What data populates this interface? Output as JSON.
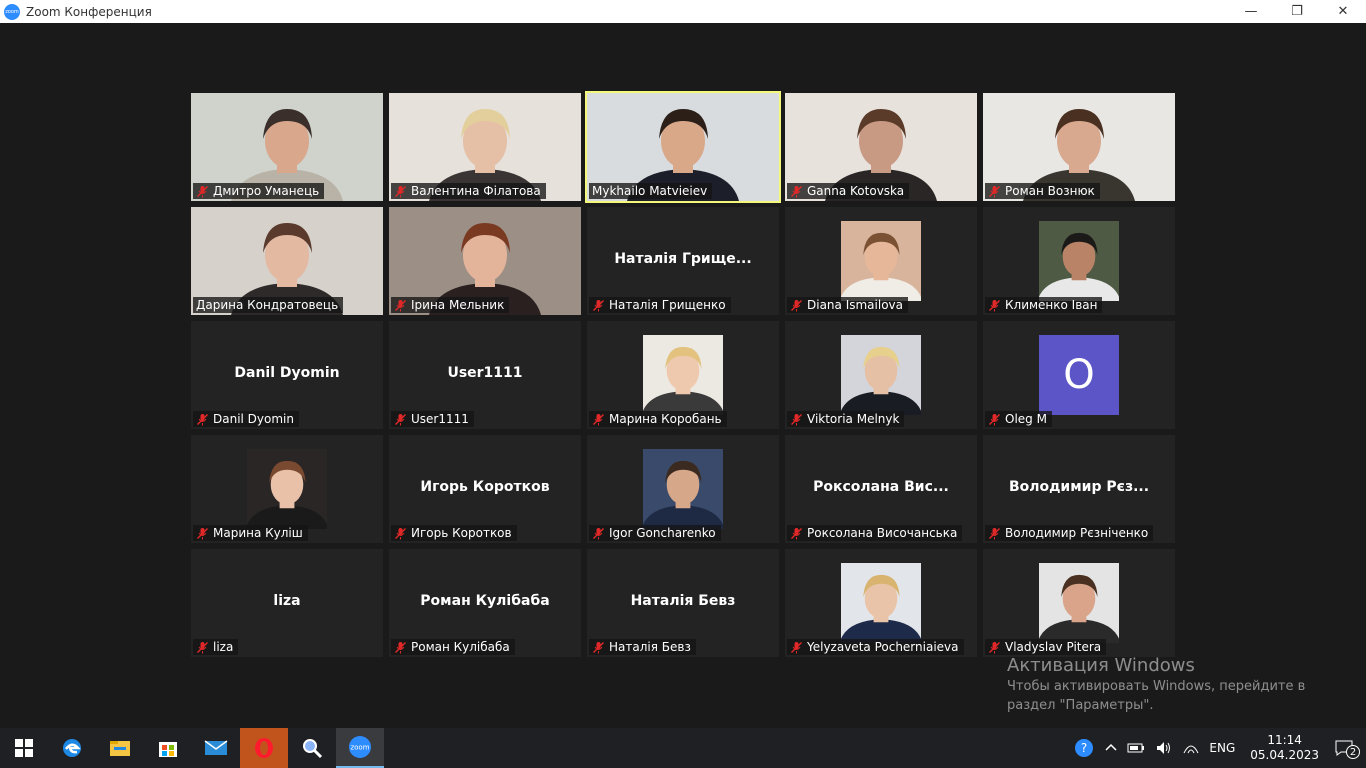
{
  "window": {
    "title": "Zoom Конференция",
    "app_icon_text": "zoom"
  },
  "participants": [
    {
      "name": "Дмитро Уманець",
      "muted": true,
      "kind": "video",
      "bg": "#cfd3cc",
      "skin": "#d8a78c",
      "hair": "#3a2f2a",
      "shirt": "#b9b2a6"
    },
    {
      "name": "Валентина Філатова",
      "muted": true,
      "kind": "video",
      "bg": "#e6e1da",
      "skin": "#e5bfa6",
      "hair": "#e3cf9c",
      "shirt": "#3a3434"
    },
    {
      "name": "Mykhailo Matvieiev",
      "muted": false,
      "kind": "video",
      "active": true,
      "bg": "#d9dcdf",
      "skin": "#d8a889",
      "hair": "#2b1f18",
      "shirt": "#1c1f2a"
    },
    {
      "name": "Ganna Kotovska",
      "muted": true,
      "kind": "video",
      "bg": "#e8e2dd",
      "skin": "#c89a83",
      "hair": "#5a3a28",
      "shirt": "#2a2626"
    },
    {
      "name": "Роман Вознюк",
      "muted": true,
      "kind": "video",
      "bg": "#e9e7e4",
      "skin": "#d8a98f",
      "hair": "#4a3020",
      "shirt": "#39362f"
    },
    {
      "name": "Дарина Кондратовець",
      "muted": false,
      "kind": "video",
      "bg": "#d6d1cb",
      "skin": "#e3b9a2",
      "hair": "#5a3a2c",
      "shirt": "#2e2a2a"
    },
    {
      "name": "Ірина Мельник",
      "muted": true,
      "kind": "video",
      "bg": "#9c8f86",
      "skin": "#e4b49a",
      "hair": "#7a3a22",
      "shirt": "#2a2020"
    },
    {
      "name": "Наталія Грищенко",
      "muted": true,
      "kind": "text",
      "center_label": "Наталія Грище..."
    },
    {
      "name": "Diana Ismailova",
      "muted": true,
      "kind": "avatar",
      "bg": "#d9b49c",
      "skin": "#e6b899",
      "hair": "#7a5233",
      "shirt": "#f0ece6"
    },
    {
      "name": "Клименко Іван",
      "muted": true,
      "kind": "avatar",
      "bg": "#4f5a45",
      "skin": "#b88366",
      "hair": "#1c1a18",
      "shirt": "#e8e8e8"
    },
    {
      "name": "Danil Dyomin",
      "muted": true,
      "kind": "text",
      "center_label": "Danil Dyomin"
    },
    {
      "name": "User1111",
      "muted": true,
      "kind": "text",
      "center_label": "User1111"
    },
    {
      "name": "Марина Коробань",
      "muted": true,
      "kind": "avatar",
      "bg": "#ece8e2",
      "skin": "#efc9ae",
      "hair": "#e2c27e",
      "shirt": "#3a3a3a"
    },
    {
      "name": "Viktoria Melnyk",
      "muted": true,
      "kind": "avatar",
      "bg": "#d3d5db",
      "skin": "#e6c0a5",
      "hair": "#e6d08c",
      "shirt": "#1a1c24"
    },
    {
      "name": "Oleg M",
      "muted": true,
      "kind": "letter",
      "letter": "O"
    },
    {
      "name": "Марина Куліш",
      "muted": true,
      "kind": "avatar",
      "bg": "#2a2626",
      "skin": "#e9c1a8",
      "hair": "#7a4a30",
      "shirt": "#1a1a1a"
    },
    {
      "name": "Игорь Коротков",
      "muted": true,
      "kind": "text",
      "center_label": "Игорь Коротков"
    },
    {
      "name": "Igor Goncharenko",
      "muted": true,
      "kind": "avatar",
      "bg": "#3a4a6a",
      "skin": "#d7a78a",
      "hair": "#3a2a20",
      "shirt": "#1e2a44"
    },
    {
      "name": "Роксолана Височанська",
      "muted": true,
      "kind": "text",
      "center_label": "Роксолана  Вис..."
    },
    {
      "name": "Володимир Рєзніченко",
      "muted": true,
      "kind": "text",
      "center_label": "Володимир  Рєз..."
    },
    {
      "name": "liza",
      "muted": true,
      "kind": "text",
      "center_label": "liza"
    },
    {
      "name": "Роман Кулібаба",
      "muted": true,
      "kind": "text",
      "center_label": "Роман Кулібаба"
    },
    {
      "name": "Наталія Бевз",
      "muted": true,
      "kind": "text",
      "center_label": "Наталія Бевз"
    },
    {
      "name": "Yelyzaveta Pocherniaieva",
      "muted": true,
      "kind": "avatar",
      "bg": "#e2e6ea",
      "skin": "#eac4a9",
      "hair": "#d9b370",
      "shirt": "#1e2a4a"
    },
    {
      "name": "Vladyslav Pitera",
      "muted": true,
      "kind": "avatar",
      "bg": "#e4e4e4",
      "skin": "#d9a48a",
      "hair": "#4a3020",
      "shirt": "#2a2a2a"
    }
  ],
  "watermark": {
    "title": "Активация Windows",
    "line1": "Чтобы активировать Windows, перейдите в",
    "line2": "раздел \"Параметры\"."
  },
  "taskbar": {
    "apps": [
      "windows-start",
      "edge",
      "file-explorer",
      "store",
      "mail",
      "opera",
      "search-tool",
      "zoom"
    ],
    "active_app": "zoom",
    "language": "ENG",
    "time": "11:14",
    "date": "05.04.2023",
    "notifications_count": "2"
  },
  "colors": {
    "active_speaker": "#f3f77a",
    "zoom_blue": "#2d8cff",
    "letter_avatar": "#5b55c8",
    "muted_red": "#e02828"
  }
}
